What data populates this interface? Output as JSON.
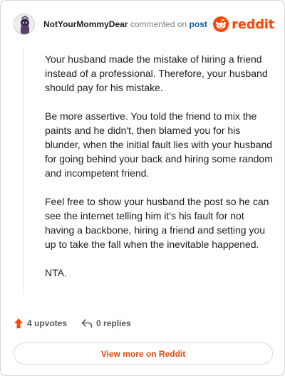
{
  "header": {
    "username": "NotYourMommyDear",
    "commented_text": "commented on",
    "post_link": "post",
    "brand": "reddit"
  },
  "comment": {
    "paragraphs": [
      "Your husband made the mistake of hiring a friend instead of a professional. Therefore, your husband should pay for his mistake.",
      "Be more assertive. You told the friend to mix the paints and he didn't, then blamed you for his blunder, when the initial fault lies with your husband for going behind your back and hiring some random and incompetent friend.",
      "Feel free to show your husband the post so he can see the internet telling him it's his fault for not having a backbone, hiring a friend and setting you up to take the fall when the inevitable happened.",
      "NTA."
    ]
  },
  "actions": {
    "upvotes": "4 upvotes",
    "replies": "0 replies"
  },
  "footer": {
    "view_more": "View more on Reddit"
  },
  "colors": {
    "brand": "#ff4500",
    "link": "#0a5ea8",
    "upvote": "#ff4500"
  },
  "icons": [
    "avatar",
    "reddit-logo-icon",
    "upvote-arrow-icon",
    "reply-icon"
  ]
}
